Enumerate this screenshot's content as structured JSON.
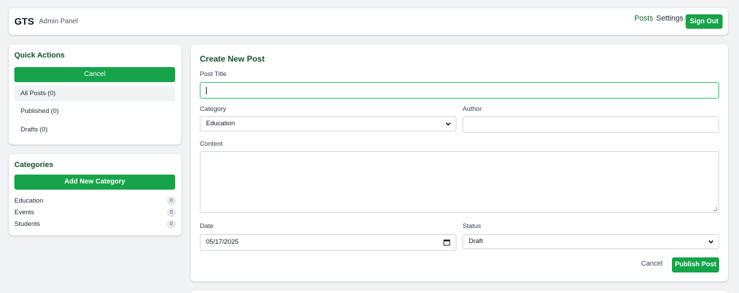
{
  "header": {
    "brand": "GTS",
    "subtitle": "Admin Panel",
    "nav": {
      "posts": "Posts",
      "settings": "Settings"
    },
    "sign_out": "Sign Out"
  },
  "quick_actions": {
    "title": "Quick Actions",
    "cancel_label": "Cancel",
    "items": [
      {
        "label": "All Posts (0)",
        "active": true
      },
      {
        "label": "Published (0)",
        "active": false
      },
      {
        "label": "Drafts (0)",
        "active": false
      }
    ]
  },
  "categories": {
    "title": "Categories",
    "add_label": "Add New Category",
    "items": [
      {
        "name": "Education",
        "count": "0"
      },
      {
        "name": "Events",
        "count": "0"
      },
      {
        "name": "Students",
        "count": "0"
      }
    ]
  },
  "form": {
    "title": "Create New Post",
    "post_title_label": "Post Title",
    "post_title_value": "",
    "category_label": "Category",
    "category_value": "Education",
    "author_label": "Author",
    "author_value": "",
    "content_label": "Content",
    "content_value": "",
    "date_label": "Date",
    "date_value": "05/17/2025",
    "status_label": "Status",
    "status_value": "Draft",
    "cancel_label": "Cancel",
    "publish_label": "Publish Post"
  },
  "icons": {
    "select_arrow": "chevron-down-icon",
    "date_picker": "calendar-icon"
  },
  "colors": {
    "accent": "#16a34a",
    "heading": "#14532d",
    "focus_border": "#22c55e",
    "background": "#f1f2f4"
  }
}
